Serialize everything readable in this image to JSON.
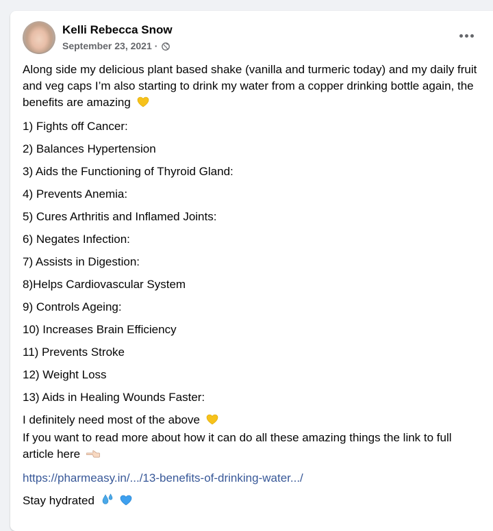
{
  "post": {
    "author": "Kelli Rebecca Snow",
    "date": "September 23, 2021",
    "separator": " · ",
    "privacy_icon": "globe-icon",
    "intro": "Along side my delicious plant based shake (vanilla and turmeric today) and my daily fruit and veg caps I’m also starting to drink my water from a copper drinking bottle again, the benefits are amazing",
    "intro_emoji": "yellow-heart",
    "benefits": [
      "1) Fights off Cancer:",
      "2) Balances Hypertension",
      "3) Aids the Functioning of Thyroid Gland:",
      "4) Prevents Anemia:",
      "5) Cures Arthritis and Inflamed Joints:",
      "6) Negates Infection:",
      "7) Assists in Digestion:",
      "8)Helps Cardiovascular System",
      "9) Controls Ageing:",
      "10) Increases Brain Efficiency",
      "11) Prevents Stroke",
      "12) Weight Loss",
      "13) Aids in Healing Wounds Faster:"
    ],
    "closing_line1": "I definitely need most of the above",
    "closing_line2": "If you want to read more about how it can do all these amazing things the link to full article here",
    "link_text": "https://pharmeasy.in/.../13-benefits-of-drinking-water.../",
    "stay_hydrated": "Stay hydrated",
    "colors": {
      "link": "#385898",
      "secondary_text": "#65676b",
      "primary_text": "#050505",
      "page_bg": "#f0f2f5",
      "card_bg": "#ffffff"
    }
  }
}
